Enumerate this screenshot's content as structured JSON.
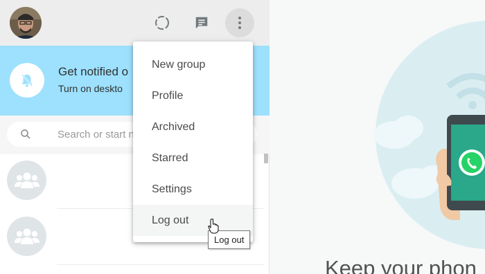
{
  "header": {
    "avatar_icon": "user-avatar",
    "status_icon": "status-ring-icon",
    "new_chat_icon": "chat-bubble-icon",
    "menu_icon": "vertical-dots-icon"
  },
  "notification_banner": {
    "icon": "bell-off-icon",
    "title": "Get notified o",
    "subtitle": "Turn on deskto"
  },
  "search": {
    "placeholder": "Search or start n",
    "icon": "search-icon"
  },
  "chat_list": {
    "items": [
      {
        "icon": "group-icon"
      },
      {
        "icon": "group-icon"
      }
    ]
  },
  "dropdown_menu": {
    "items": [
      {
        "label": "New group"
      },
      {
        "label": "Profile"
      },
      {
        "label": "Archived"
      },
      {
        "label": "Starred"
      },
      {
        "label": "Settings"
      },
      {
        "label": "Log out"
      }
    ],
    "hovered_item": "Log out"
  },
  "tooltip": {
    "text": "Log out"
  },
  "right_pane": {
    "heading": "Keep your phon",
    "logo": "whatsapp-logo"
  },
  "colors": {
    "header_bg": "#ededed",
    "banner_bg": "#9de1fe",
    "brand_green": "#25d366",
    "hero_circle": "#daeef2"
  }
}
